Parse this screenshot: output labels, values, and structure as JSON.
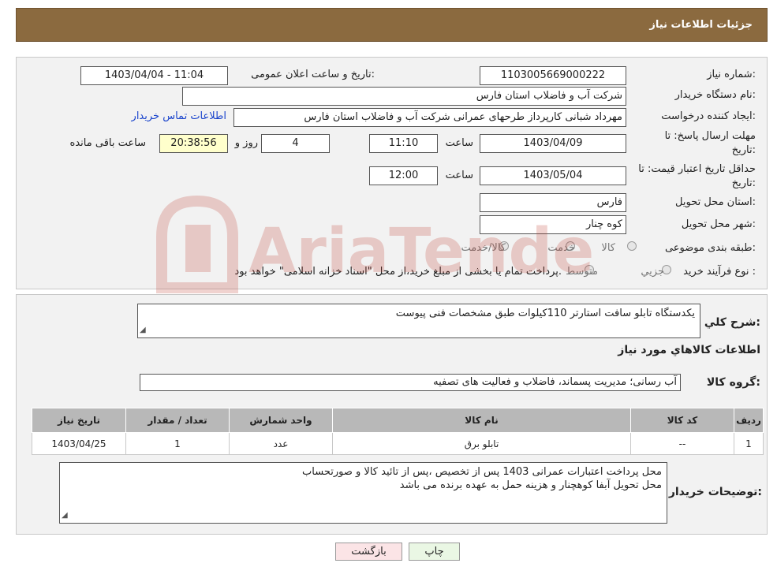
{
  "header": {
    "title": "جزئیات اطلاعات نیاز"
  },
  "form": {
    "need_number_label": "شماره نیاز:",
    "need_number": "1103005669000222",
    "announce_label": "تاریخ و ساعت اعلان عمومی:",
    "announce_value": "1403/04/04 - 11:04",
    "buyer_org_label": "نام دستگاه خریدار:",
    "buyer_org": "شرکت آب و فاضلاب استان فارس",
    "creator_label": "ایجاد کننده درخواست:",
    "creator": "مهرداد شبانی کارپرداز طرحهای عمرانی  شرکت آب و فاضلاب استان فارس",
    "contact_link": "اطلاعات تماس خریدار",
    "deadline_label_1": "مهلت ارسال پاسخ: تا",
    "deadline_label_2": "تاریخ:",
    "deadline_date": "1403/04/09",
    "time_label": "ساعت",
    "deadline_time": "11:10",
    "days_value": "4",
    "days_label": "روز و",
    "remaining_time": "20:38:56",
    "remaining_label": "ساعت باقی مانده",
    "validity_label_1": "حداقل تاریخ اعتبار قیمت: تا",
    "validity_label_2": "تاریخ:",
    "validity_date": "1403/05/04",
    "validity_time_label": "ساعت",
    "validity_time": "12:00",
    "province_label": "استان محل تحویل:",
    "province": "فارس",
    "city_label": "شهر محل تحویل:",
    "city": "کوه چنار",
    "category_label": "طبقه بندی موضوعی:",
    "category_options": [
      "کالا",
      "خدمت",
      "کالا/خدمت"
    ],
    "purchase_type_label": "نوع فرآیند خرید :",
    "purchase_options": [
      "جزیي",
      "متوسط"
    ],
    "purchase_note": "پرداخت تمام یا بخشی از مبلغ خرید،از محل \"اسناد خزانه اسلامی\" خواهد بود."
  },
  "details": {
    "summary_label": "شرح کلي نياز:",
    "summary": "یکدستگاه تابلو سافت استارتر 110کیلوات طبق مشخصات فنی پیوست",
    "goods_info_title": "اطلاعات کالاهاي مورد نياز",
    "goods_group_label": "گروه کالا:",
    "goods_group": "آب رسانی؛ مدیریت پسماند، فاضلاب و فعالیت های تصفیه",
    "table": {
      "headers": [
        "ردیف",
        "کد کالا",
        "نام کالا",
        "واحد شمارش",
        "تعداد / مقدار",
        "تاریخ نیاز"
      ],
      "rows": [
        [
          "1",
          "--",
          "تابلو برق",
          "عدد",
          "1",
          "1403/04/25"
        ]
      ]
    },
    "buyer_notes_label": "توضیحات خریدار:",
    "buyer_notes_line1": "محل پرداخت اعتبارات عمرانی 1403 پس از تخصیص ،پس از تائید کالا و صورتحساب",
    "buyer_notes_line2": "محل تحویل آبفا  کوهچنار و هزینه حمل به عهده برنده می باشد"
  },
  "buttons": {
    "print": "چاپ",
    "back": "بازگشت"
  },
  "watermark": {
    "text": "AriaTender.neT"
  },
  "colors": {
    "header_bg": "#8b6a3f",
    "link": "#1a44cc",
    "table_header": "#b8b8b8",
    "remaining_bg": "#ffffcc"
  }
}
